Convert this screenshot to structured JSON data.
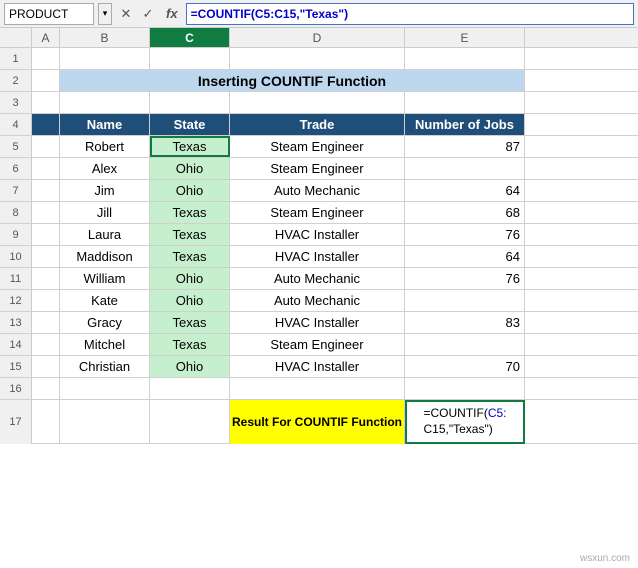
{
  "namebox": {
    "value": "PRODUCT",
    "dropdown_symbol": "▾"
  },
  "formula_bar": {
    "formula_text": "=COUNTIF(C5:C15,\"Texas\")",
    "fx_label": "fx"
  },
  "col_headers": [
    "A",
    "B",
    "C",
    "D",
    "E"
  ],
  "title": "Inserting COUNTIF Function",
  "table_headers": {
    "name": "Name",
    "state": "State",
    "trade": "Trade",
    "jobs": "Number of Jobs"
  },
  "rows": [
    {
      "row": "1",
      "b": "",
      "c": "",
      "d": "",
      "e": ""
    },
    {
      "row": "2",
      "b": "",
      "c": "",
      "d": "title",
      "e": ""
    },
    {
      "row": "3",
      "b": "",
      "c": "",
      "d": "",
      "e": ""
    },
    {
      "row": "4",
      "b": "Name",
      "c": "State",
      "d": "Trade",
      "e": "Number of Jobs",
      "is_header": true
    },
    {
      "row": "5",
      "b": "Robert",
      "c": "Texas",
      "d": "Steam Engineer",
      "e": "87"
    },
    {
      "row": "6",
      "b": "Alex",
      "c": "Ohio",
      "d": "Steam Engineer",
      "e": ""
    },
    {
      "row": "7",
      "b": "Jim",
      "c": "Ohio",
      "d": "Auto Mechanic",
      "e": "64"
    },
    {
      "row": "8",
      "b": "Jill",
      "c": "Texas",
      "d": "Steam Engineer",
      "e": "68"
    },
    {
      "row": "9",
      "b": "Laura",
      "c": "Texas",
      "d": "HVAC Installer",
      "e": "76"
    },
    {
      "row": "10",
      "b": "Maddison",
      "c": "Texas",
      "d": "HVAC Installer",
      "e": "64"
    },
    {
      "row": "11",
      "b": "William",
      "c": "Ohio",
      "d": "Auto Mechanic",
      "e": "76"
    },
    {
      "row": "12",
      "b": "Kate",
      "c": "Ohio",
      "d": "Auto Mechanic",
      "e": ""
    },
    {
      "row": "13",
      "b": "Gracy",
      "c": "Texas",
      "d": "HVAC Installer",
      "e": "83"
    },
    {
      "row": "14",
      "b": "Mitchel",
      "c": "Texas",
      "d": "Steam Engineer",
      "e": ""
    },
    {
      "row": "15",
      "b": "Christian",
      "c": "Ohio",
      "d": "HVAC Installer",
      "e": "70"
    },
    {
      "row": "16",
      "b": "",
      "c": "",
      "d": "",
      "e": ""
    },
    {
      "row": "17",
      "b": "",
      "c": "",
      "d": "Result For COUNTIF Function",
      "e": "formula",
      "is_result": true
    }
  ],
  "result_label": "Result For COUNTIF Function",
  "formula_cell_text": "=COUNTIF(C5: C15,\"Texas\")",
  "formula_cell_highlight": "C5:",
  "watermark": "wsxun.com"
}
